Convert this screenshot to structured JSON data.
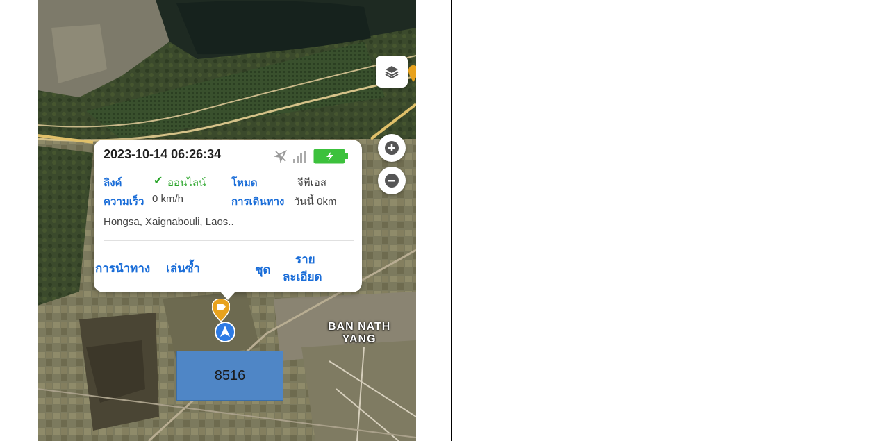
{
  "popup": {
    "timestamp": "2023-10-14 06:26:34",
    "link_label": "ลิงค์",
    "link_value": "ออนไลน์",
    "mode_label": "โหมด",
    "mode_value": "จีพีเอส",
    "speed_label": "ความเร็ว",
    "speed_value": "0 km/h",
    "trip_label": "การเดินทาง",
    "trip_value": "วันนี้ 0km",
    "address": "Hongsa, Xaignabouli, Laos..",
    "actions": {
      "navigate": "การนำทาง",
      "replay": "เล่นซ้ำ",
      "set": "ชุด",
      "details_line1": "ราย",
      "details_line2": "ละเอียด"
    }
  },
  "map": {
    "place_line1": "BAN NATH",
    "place_line2": "YANG",
    "vehicle_label": "8516"
  },
  "icons": {
    "layers": "layers-icon",
    "zoom_in": "zoom-in-icon",
    "zoom_out": "zoom-out-icon",
    "gps_off": "gps-off-icon",
    "signal": "signal-icon",
    "battery": "battery-charging-icon",
    "check": "check-icon",
    "vehicle": "navigation-arrow-icon",
    "cafe": "cafe-marker-icon"
  },
  "colors": {
    "accent": "#1a6dd8",
    "online": "#2aa52a",
    "battery": "#3cc13c",
    "vehicle_box": "#4f86c6"
  }
}
